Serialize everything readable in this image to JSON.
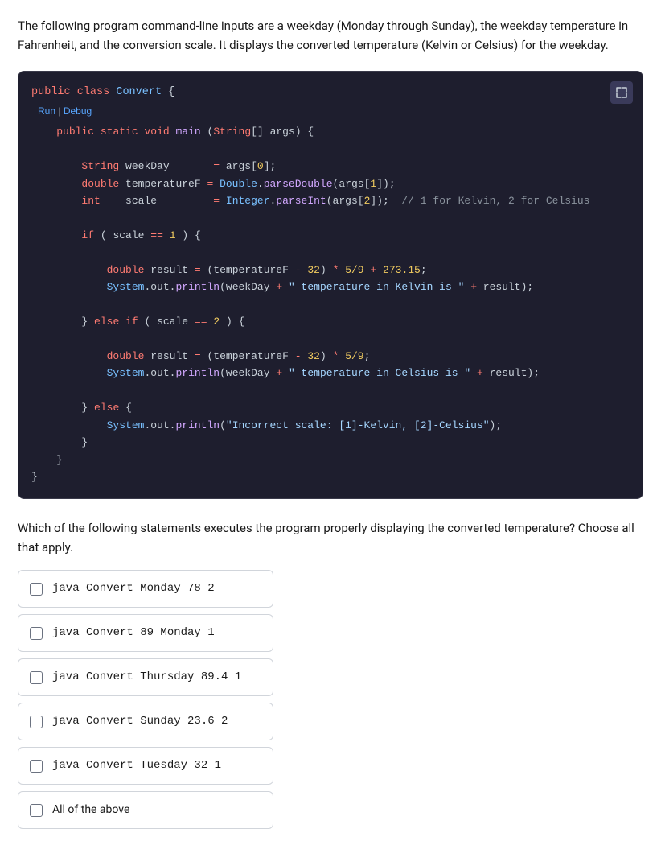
{
  "description": {
    "text": "The following program command-line inputs are a weekday (Monday through Sunday), the weekday temperature in Fahrenheit, and the conversion scale. It displays the converted temperature (Kelvin or Celsius) for the weekday."
  },
  "code": {
    "class_line": "public class Convert {",
    "run_label": "Run",
    "debug_label": "Debug",
    "expand_icon": "⤢"
  },
  "question": {
    "text": "Which of the following statements executes the program properly displaying the converted temperature? Choose all that apply."
  },
  "options": [
    {
      "id": "opt1",
      "label": "java Convert Monday 78 2"
    },
    {
      "id": "opt2",
      "label": "java Convert 89 Monday 1"
    },
    {
      "id": "opt3",
      "label": "java Convert Thursday 89.4 1"
    },
    {
      "id": "opt4",
      "label": "java Convert Sunday 23.6 2"
    },
    {
      "id": "opt5",
      "label": "java Convert Tuesday 32 1"
    },
    {
      "id": "opt6",
      "label": "All of the above",
      "isText": true
    }
  ]
}
